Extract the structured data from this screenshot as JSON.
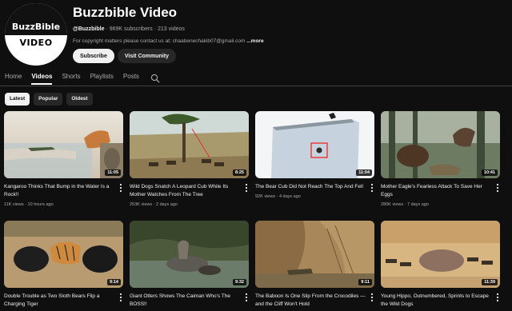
{
  "channel": {
    "avatar_top": "BuzzBible",
    "avatar_bottom": "VIDEO",
    "name": "Buzzbible Video",
    "handle": "@Buzzbible",
    "stats": " · 969K subscribers · 213 videos",
    "description": "For copyright matters please contact us at: chaabenechakib07@gmail.com ",
    "more_label": "...more",
    "subscribe_label": "Subscribe",
    "community_label": "Visit Community"
  },
  "tabs": [
    {
      "label": "Home",
      "active": false
    },
    {
      "label": "Videos",
      "active": true
    },
    {
      "label": "Shorts",
      "active": false
    },
    {
      "label": "Playlists",
      "active": false
    },
    {
      "label": "Posts",
      "active": false
    }
  ],
  "chips": [
    {
      "label": "Latest",
      "active": true
    },
    {
      "label": "Popular",
      "active": false
    },
    {
      "label": "Oldest",
      "active": false
    }
  ],
  "videos": [
    {
      "title": "Kangaroo Thinks That Bump in the Water Is a Rock!!",
      "meta": "11K views · 10 hours ago",
      "duration": "11:05"
    },
    {
      "title": "Wild Dogs Snatch A Leopard Cub While Its Mother Watches From The Tree",
      "meta": "253K views · 2 days ago",
      "duration": "8:25"
    },
    {
      "title": "The Bear Cub Did Not Reach The Top And Fell",
      "meta": "92K views · 4 days ago",
      "duration": "11:04"
    },
    {
      "title": "Mother Eagle's Fearless Attack To Save Her Eggs",
      "meta": "280K views · 7 days ago",
      "duration": "10:41"
    },
    {
      "title": "Double Trouble as Two Sloth Bears Flip a Charging Tiger",
      "meta": "",
      "duration": "9:14"
    },
    {
      "title": "Giant Otters Shows The Caiman Who's The BOSS!!",
      "meta": "",
      "duration": "9:32"
    },
    {
      "title": "The Baboon Is One Slip From the Crocodiles — and the Cliff Won't Hold",
      "meta": "",
      "duration": "9:11"
    },
    {
      "title": "Young Hippo, Outnumbered, Sprints to Escape the Wild Dogs",
      "meta": "",
      "duration": "11:39"
    }
  ]
}
